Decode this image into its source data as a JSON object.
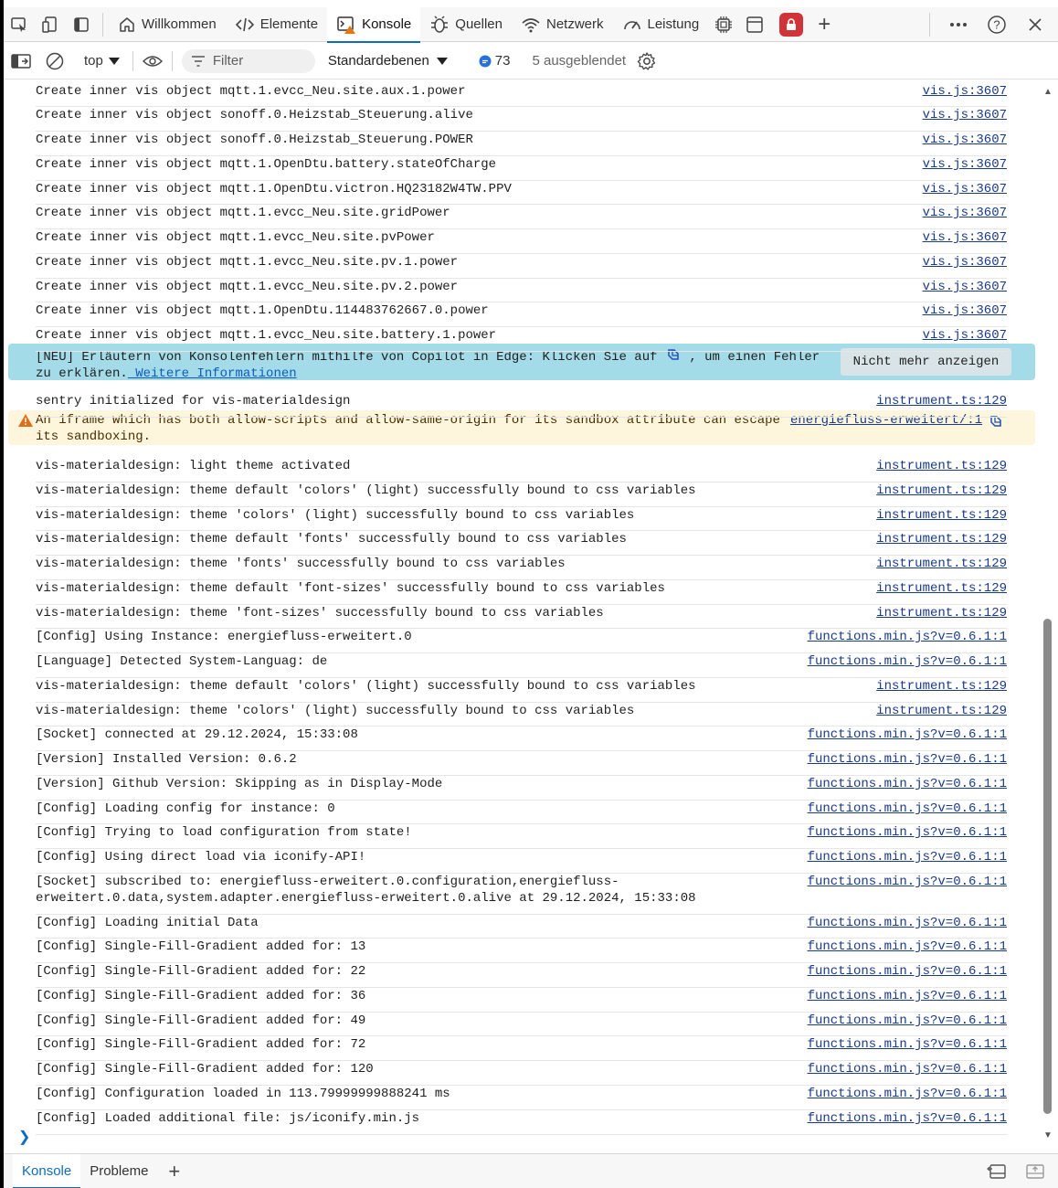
{
  "tabs": [
    {
      "label": "Willkommen",
      "icon": "home-icon"
    },
    {
      "label": "Elemente",
      "icon": "code-icon"
    },
    {
      "label": "Konsole",
      "icon": "console-icon"
    },
    {
      "label": "Quellen",
      "icon": "bug-icon"
    },
    {
      "label": "Netzwerk",
      "icon": "wifi-icon"
    },
    {
      "label": "Leistung",
      "icon": "gauge-icon"
    }
  ],
  "toolbar": {
    "context": "top",
    "filter_placeholder": "Filter",
    "levels": "Standardebenen",
    "message_count": "73",
    "hidden": "5 ausgeblendet"
  },
  "logs": [
    {
      "msg": "Create inner vis object mqtt.1.evcc_Neu.site.aux.1.power",
      "src": "vis.js:3607"
    },
    {
      "msg": "Create inner vis object sonoff.0.Heizstab_Steuerung.alive",
      "src": "vis.js:3607"
    },
    {
      "msg": "Create inner vis object sonoff.0.Heizstab_Steuerung.POWER",
      "src": "vis.js:3607"
    },
    {
      "msg": "Create inner vis object mqtt.1.OpenDtu.battery.stateOfCharge",
      "src": "vis.js:3607"
    },
    {
      "msg": "Create inner vis object mqtt.1.OpenDtu.victron.HQ23182W4TW.PPV",
      "src": "vis.js:3607"
    },
    {
      "msg": "Create inner vis object mqtt.1.evcc_Neu.site.gridPower",
      "src": "vis.js:3607"
    },
    {
      "msg": "Create inner vis object mqtt.1.evcc_Neu.site.pvPower",
      "src": "vis.js:3607"
    },
    {
      "msg": "Create inner vis object mqtt.1.evcc_Neu.site.pv.1.power",
      "src": "vis.js:3607"
    },
    {
      "msg": "Create inner vis object mqtt.1.evcc_Neu.site.pv.2.power",
      "src": "vis.js:3607"
    },
    {
      "msg": "Create inner vis object mqtt.1.OpenDtu.114483762667.0.power",
      "src": "vis.js:3607"
    },
    {
      "msg": "Create inner vis object mqtt.1.evcc_Neu.site.battery.1.power",
      "src": "vis.js:3607"
    },
    {
      "msg": "sentry initialized for vis-materialdesign",
      "src": "instrument.ts:129"
    },
    {
      "msg": "vis-materialdesign: light theme activated",
      "src": "instrument.ts:129"
    },
    {
      "msg": "vis-materialdesign: theme default 'colors' (light) successfully bound to css variables",
      "src": "instrument.ts:129"
    },
    {
      "msg": "vis-materialdesign: theme 'colors' (light) successfully bound to css variables",
      "src": "instrument.ts:129"
    },
    {
      "msg": "vis-materialdesign: theme default 'fonts' successfully bound to css variables",
      "src": "instrument.ts:129"
    },
    {
      "msg": "vis-materialdesign: theme 'fonts' successfully bound to css variables",
      "src": "instrument.ts:129"
    },
    {
      "msg": "vis-materialdesign: theme default 'font-sizes' successfully bound to css variables",
      "src": "instrument.ts:129"
    },
    {
      "msg": "vis-materialdesign: theme 'font-sizes' successfully bound to css variables",
      "src": "instrument.ts:129"
    },
    {
      "msg": "[Config] Using Instance: energiefluss-erweitert.0",
      "src": "functions.min.js?v=0.6.1:1"
    },
    {
      "msg": "[Language] Detected System-Languag: de",
      "src": "functions.min.js?v=0.6.1:1"
    },
    {
      "msg": "vis-materialdesign: theme default 'colors' (light) successfully bound to css variables",
      "src": "instrument.ts:129"
    },
    {
      "msg": "vis-materialdesign: theme 'colors' (light) successfully bound to css variables",
      "src": "instrument.ts:129"
    },
    {
      "msg": "[Socket] connected at 29.12.2024, 15:33:08",
      "src": "functions.min.js?v=0.6.1:1"
    },
    {
      "msg": "[Version] Installed Version: 0.6.2",
      "src": "functions.min.js?v=0.6.1:1"
    },
    {
      "msg": "[Version] Github Version: Skipping as in Display-Mode",
      "src": "functions.min.js?v=0.6.1:1"
    },
    {
      "msg": "[Config] Loading config for instance: 0",
      "src": "functions.min.js?v=0.6.1:1"
    },
    {
      "msg": "[Config] Trying to load configuration from state!",
      "src": "functions.min.js?v=0.6.1:1"
    },
    {
      "msg": "[Config] Using direct load via iconify-API!",
      "src": "functions.min.js?v=0.6.1:1"
    },
    {
      "msg": "[Socket] subscribed to: energiefluss-erweitert.0.configuration,energiefluss-erweitert.0.data,system.adapter.energiefluss-erweitert.0.alive at 29.12.2024, 15:33:08",
      "src": "functions.min.js?v=0.6.1:1"
    },
    {
      "msg": "[Config] Loading initial Data",
      "src": "functions.min.js?v=0.6.1:1"
    },
    {
      "msg": "[Config] Single-Fill-Gradient added for: 13",
      "src": "functions.min.js?v=0.6.1:1"
    },
    {
      "msg": "[Config] Single-Fill-Gradient added for: 22",
      "src": "functions.min.js?v=0.6.1:1"
    },
    {
      "msg": "[Config] Single-Fill-Gradient added for: 36",
      "src": "functions.min.js?v=0.6.1:1"
    },
    {
      "msg": "[Config] Single-Fill-Gradient added for: 49",
      "src": "functions.min.js?v=0.6.1:1"
    },
    {
      "msg": "[Config] Single-Fill-Gradient added for: 72",
      "src": "functions.min.js?v=0.6.1:1"
    },
    {
      "msg": "[Config] Single-Fill-Gradient added for: 120",
      "src": "functions.min.js?v=0.6.1:1"
    },
    {
      "msg": "[Config] Configuration loaded in 113.79999999888241 ms",
      "src": "functions.min.js?v=0.6.1:1"
    },
    {
      "msg": "[Config] Loaded additional file: js/iconify.min.js",
      "src": "functions.min.js?v=0.6.1:1"
    }
  ],
  "banner": {
    "text_before": "[NEU] Erläutern von Konsolenfehlern mithilfe von Copilot in Edge: Klicken Sie auf ",
    "text_after": " , um einen Fehler zu erklären.",
    "link": " Weitere Informationen",
    "button": "Nicht mehr anzeigen"
  },
  "warning": {
    "text": "An iframe which has both allow-scripts and allow-same-origin for its sandbox attribute can escape its sandboxing.",
    "src": "energiefluss-erweitert/:1"
  },
  "drawer": {
    "tabs": [
      "Konsole",
      "Probleme"
    ]
  },
  "colors": {
    "accent": "#0f6cbd",
    "banner_bg": "#a4dbe9",
    "warning_bg": "#fdf6dc",
    "link": "#1a3a8a"
  }
}
